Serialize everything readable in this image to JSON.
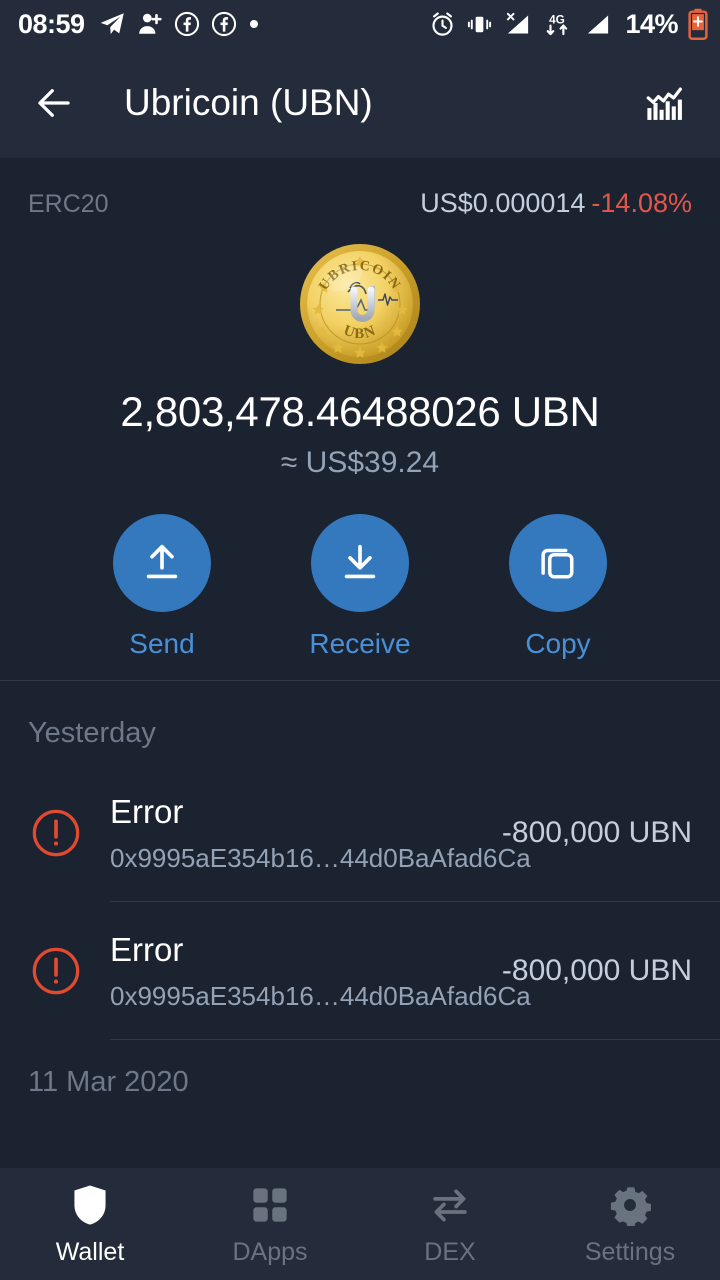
{
  "status_bar": {
    "time": "08:59",
    "battery_text": "14%",
    "left_icons": [
      "telegram-icon",
      "add-person-icon",
      "facebook-icon",
      "facebook-icon",
      "dot-icon"
    ],
    "right_icons": [
      "alarm-icon",
      "vibrate-icon",
      "no-sim-signal-icon",
      "4g-data-icon",
      "signal-bars-icon"
    ],
    "battery_icon": "battery-charging-icon"
  },
  "app_bar": {
    "back_icon": "back-arrow-icon",
    "title": "Ubricoin (UBN)",
    "chart_icon": "bar-chart-icon"
  },
  "token": {
    "chain": "ERC20",
    "price": "US$0.000014",
    "change": "-14.08%",
    "change_color": "#e2574c",
    "logo_icon": "ubricoin-logo",
    "logo_top_text": "UBRICOIN",
    "logo_bottom_text": "UBN",
    "balance": "2,803,478.46488026 UBN",
    "balance_usd": "≈ US$39.24"
  },
  "actions": [
    {
      "label": "Send",
      "icon": "upload-arrow-icon"
    },
    {
      "label": "Receive",
      "icon": "download-arrow-icon"
    },
    {
      "label": "Copy",
      "icon": "copy-icon"
    }
  ],
  "accent_color": "#3479bd",
  "action_label_color": "#4a90d9",
  "transactions": {
    "groups": [
      {
        "date": "Yesterday",
        "rows": [
          {
            "status_icon": "error-alert-icon",
            "title": "Error",
            "address": "0x9995aE354b16…44d0BaAfad6Ca",
            "amount": "-800,000 UBN"
          },
          {
            "status_icon": "error-alert-icon",
            "title": "Error",
            "address": "0x9995aE354b16…44d0BaAfad6Ca",
            "amount": "-800,000 UBN"
          }
        ]
      },
      {
        "date": "11 Mar 2020",
        "rows": []
      }
    ]
  },
  "bottom_nav": [
    {
      "label": "Wallet",
      "icon": "shield-icon",
      "active": true
    },
    {
      "label": "DApps",
      "icon": "grid-squares-icon",
      "active": false
    },
    {
      "label": "DEX",
      "icon": "swap-arrows-icon",
      "active": false
    },
    {
      "label": "Settings",
      "icon": "gear-icon",
      "active": false
    }
  ]
}
